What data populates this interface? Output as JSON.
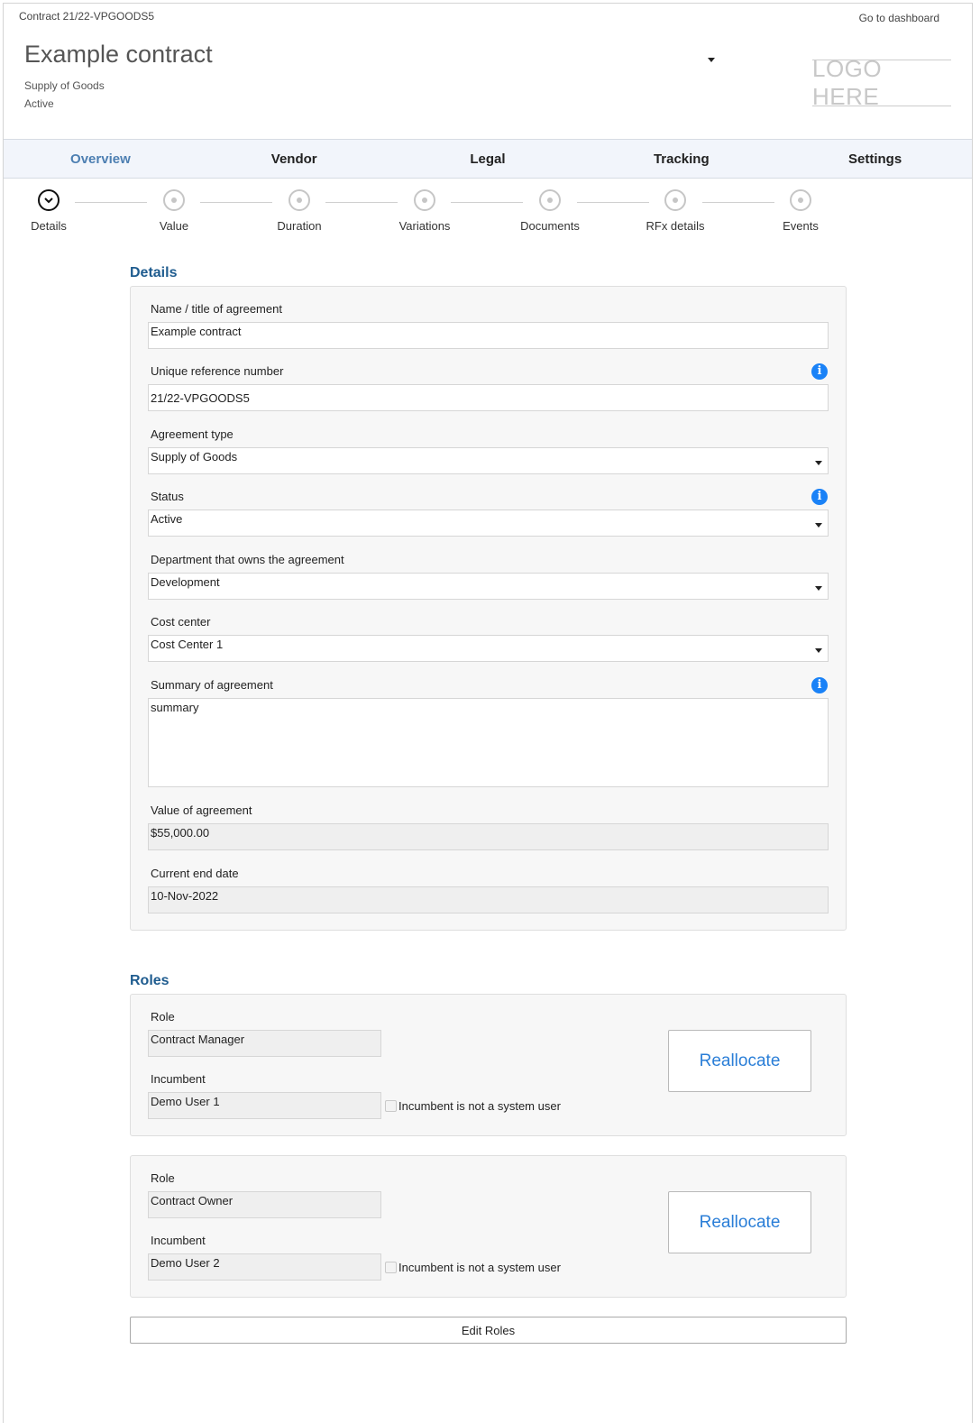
{
  "header": {
    "contract_ref": "Contract 21/22-VPGOODS5",
    "dashboard_link": "Go to dashboard",
    "title": "Example contract",
    "type": "Supply of Goods",
    "status": "Active",
    "logo_text": "LOGO HERE"
  },
  "tabs": [
    {
      "label": "Overview",
      "active": true
    },
    {
      "label": "Vendor",
      "active": false
    },
    {
      "label": "Legal",
      "active": false
    },
    {
      "label": "Tracking",
      "active": false
    },
    {
      "label": "Settings",
      "active": false
    }
  ],
  "steps": [
    {
      "label": "Details",
      "current": true
    },
    {
      "label": "Value",
      "current": false
    },
    {
      "label": "Duration",
      "current": false
    },
    {
      "label": "Variations",
      "current": false
    },
    {
      "label": "Documents",
      "current": false
    },
    {
      "label": "RFx details",
      "current": false
    },
    {
      "label": "Events",
      "current": false
    }
  ],
  "details": {
    "heading": "Details",
    "info_icon": "i",
    "fields": {
      "name": {
        "label": "Name / title of agreement",
        "value": "Example contract"
      },
      "ref": {
        "label": "Unique reference number",
        "value": "21/22-VPGOODS5"
      },
      "type": {
        "label": "Agreement type",
        "value": "Supply of Goods"
      },
      "status": {
        "label": "Status",
        "value": "Active"
      },
      "department": {
        "label": "Department that owns the agreement",
        "value": "Development"
      },
      "cost_center": {
        "label": "Cost center",
        "value": "Cost Center 1"
      },
      "summary": {
        "label": "Summary of agreement",
        "value": "summary"
      },
      "value": {
        "label": "Value of agreement",
        "value": "$55,000.00"
      },
      "end_date": {
        "label": "Current end date",
        "value": "10-Nov-2022"
      }
    }
  },
  "roles": {
    "heading": "Roles",
    "items": [
      {
        "role_label": "Role",
        "role": "Contract Manager",
        "incumbent_label": "Incumbent",
        "incumbent": "Demo User 1",
        "checkbox_label": "Incumbent is not a system user",
        "checked": false,
        "button": "Reallocate"
      },
      {
        "role_label": "Role",
        "role": "Contract Owner",
        "incumbent_label": "Incumbent",
        "incumbent": "Demo User 2",
        "checkbox_label": "Incumbent is not a system user",
        "checked": false,
        "button": "Reallocate"
      }
    ],
    "edit_button": "Edit Roles"
  },
  "colors": {
    "accent": "#1f5c8f",
    "tab_active": "#4d7fb2",
    "info_blue": "#1a82f7",
    "link_blue": "#2a7ed7"
  }
}
